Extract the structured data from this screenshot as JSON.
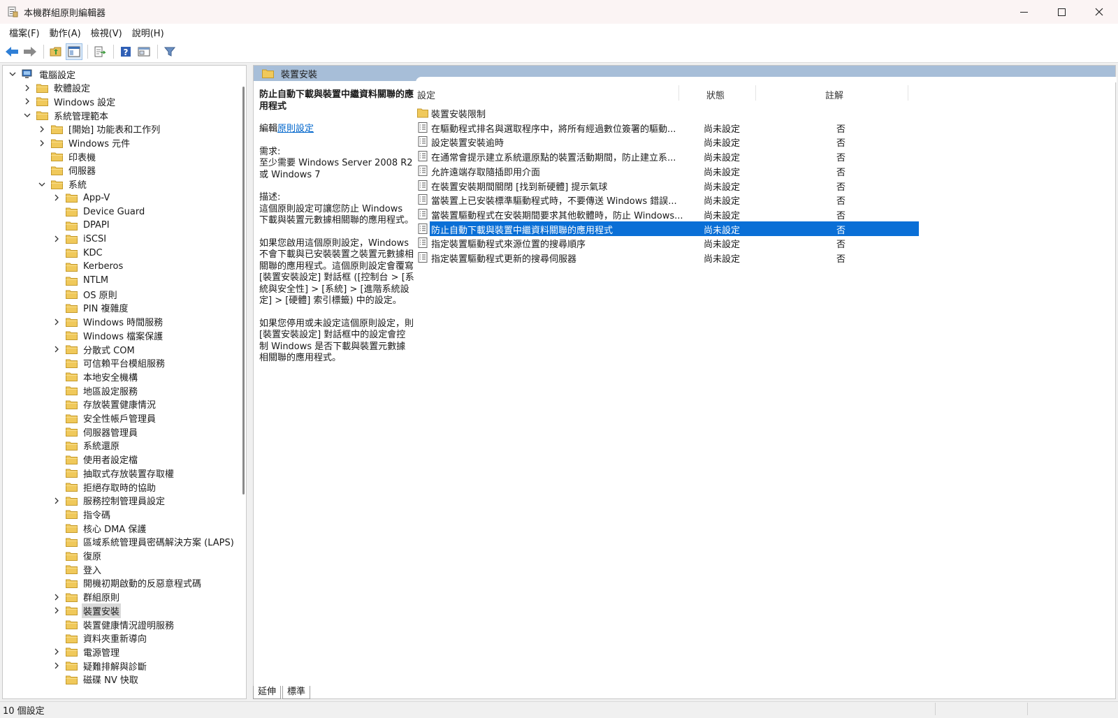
{
  "window": {
    "title": "本機群組原則編輯器"
  },
  "menu": [
    "檔案(F)",
    "動作(A)",
    "檢視(V)",
    "說明(H)"
  ],
  "toolbar": {
    "icons": [
      "back-arrow-icon",
      "forward-arrow-icon",
      "up-folder-icon",
      "show-hide-tree-icon",
      "export-list-icon",
      "help-icon",
      "properties-icon",
      "filter-icon"
    ]
  },
  "tree": [
    {
      "label": "電腦設定",
      "level": 0,
      "expander": "expanded",
      "icon": "computer"
    },
    {
      "label": "軟體設定",
      "level": 1,
      "expander": "collapsed"
    },
    {
      "label": "Windows 設定",
      "level": 1,
      "expander": "collapsed"
    },
    {
      "label": "系統管理範本",
      "level": 1,
      "expander": "expanded"
    },
    {
      "label": "[開始] 功能表和工作列",
      "level": 2,
      "expander": "collapsed"
    },
    {
      "label": "Windows 元件",
      "level": 2,
      "expander": "collapsed"
    },
    {
      "label": "印表機",
      "level": 2,
      "expander": "none"
    },
    {
      "label": "伺服器",
      "level": 2,
      "expander": "none"
    },
    {
      "label": "系統",
      "level": 2,
      "expander": "expanded"
    },
    {
      "label": "App-V",
      "level": 3,
      "expander": "collapsed"
    },
    {
      "label": "Device Guard",
      "level": 3,
      "expander": "none"
    },
    {
      "label": "DPAPI",
      "level": 3,
      "expander": "none"
    },
    {
      "label": "iSCSI",
      "level": 3,
      "expander": "collapsed"
    },
    {
      "label": "KDC",
      "level": 3,
      "expander": "none"
    },
    {
      "label": "Kerberos",
      "level": 3,
      "expander": "none"
    },
    {
      "label": "NTLM",
      "level": 3,
      "expander": "none"
    },
    {
      "label": "OS 原則",
      "level": 3,
      "expander": "none"
    },
    {
      "label": "PIN 複雜度",
      "level": 3,
      "expander": "none"
    },
    {
      "label": "Windows 時間服務",
      "level": 3,
      "expander": "collapsed"
    },
    {
      "label": "Windows 檔案保護",
      "level": 3,
      "expander": "none"
    },
    {
      "label": "分散式 COM",
      "level": 3,
      "expander": "collapsed"
    },
    {
      "label": "可信賴平台模組服務",
      "level": 3,
      "expander": "none"
    },
    {
      "label": "本地安全機構",
      "level": 3,
      "expander": "none"
    },
    {
      "label": "地區設定服務",
      "level": 3,
      "expander": "none"
    },
    {
      "label": "存放裝置健康情況",
      "level": 3,
      "expander": "none"
    },
    {
      "label": "安全性帳戶管理員",
      "level": 3,
      "expander": "none"
    },
    {
      "label": "伺服器管理員",
      "level": 3,
      "expander": "none"
    },
    {
      "label": "系統還原",
      "level": 3,
      "expander": "none"
    },
    {
      "label": "使用者設定檔",
      "level": 3,
      "expander": "none"
    },
    {
      "label": "抽取式存放裝置存取權",
      "level": 3,
      "expander": "none"
    },
    {
      "label": "拒絕存取時的協助",
      "level": 3,
      "expander": "none"
    },
    {
      "label": "服務控制管理員設定",
      "level": 3,
      "expander": "collapsed"
    },
    {
      "label": "指令碼",
      "level": 3,
      "expander": "none"
    },
    {
      "label": "核心 DMA 保護",
      "level": 3,
      "expander": "none"
    },
    {
      "label": "區域系統管理員密碼解決方案 (LAPS)",
      "level": 3,
      "expander": "none"
    },
    {
      "label": "復原",
      "level": 3,
      "expander": "none"
    },
    {
      "label": "登入",
      "level": 3,
      "expander": "none"
    },
    {
      "label": "開機初期啟動的反惡意程式碼",
      "level": 3,
      "expander": "none"
    },
    {
      "label": "群組原則",
      "level": 3,
      "expander": "collapsed"
    },
    {
      "label": "裝置安裝",
      "level": 3,
      "expander": "collapsed",
      "selected": true
    },
    {
      "label": "裝置健康情況證明服務",
      "level": 3,
      "expander": "none"
    },
    {
      "label": "資料夾重新導向",
      "level": 3,
      "expander": "none"
    },
    {
      "label": "電源管理",
      "level": 3,
      "expander": "collapsed"
    },
    {
      "label": "疑難排解與診斷",
      "level": 3,
      "expander": "collapsed"
    },
    {
      "label": "磁碟 NV 快取",
      "level": 3,
      "expander": "none"
    }
  ],
  "right": {
    "header": "裝置安裝",
    "description": {
      "title": "防止自動下載與裝置中繼資料關聯的應用程式",
      "edit_prefix": "編輯",
      "edit_link": "原則設定",
      "req_label": "需求:",
      "req_text": "至少需要 Windows Server 2008 R2 或 Windows 7",
      "desc_label": "描述:",
      "desc_text": "這個原則設定可讓您防止 Windows 下載與裝置元數據相關聯的應用程式。",
      "para2": "如果您啟用這個原則設定，Windows 不會下載與已安裝裝置之裝置元數據相關聯的應用程式。這個原則設定會覆寫 [裝置安裝設定] 對話框 ([控制台 > [系統與安全性] > [系統] > [進階系統設定] > [硬體] 索引標籤) 中的設定。",
      "para3": "如果您停用或未設定這個原則設定，則 [裝置安裝設定] 對話框中的設定會控制 Windows 是否下載與裝置元數據相關聯的應用程式。"
    },
    "columns": {
      "setting": "設定",
      "state": "狀態",
      "comment": "註解"
    },
    "rows": [
      {
        "name": "裝置安裝限制",
        "type": "folder",
        "state": "",
        "comment": ""
      },
      {
        "name": "在驅動程式排名與選取程序中，將所有經過數位簽署的驅動...",
        "type": "setting",
        "state": "尚未設定",
        "comment": "否"
      },
      {
        "name": "設定裝置安裝逾時",
        "type": "setting",
        "state": "尚未設定",
        "comment": "否"
      },
      {
        "name": "在通常會提示建立系統還原點的裝置活動期間，防止建立系...",
        "type": "setting",
        "state": "尚未設定",
        "comment": "否"
      },
      {
        "name": "允許遠端存取隨插即用介面",
        "type": "setting",
        "state": "尚未設定",
        "comment": "否"
      },
      {
        "name": "在裝置安裝期間關閉 [找到新硬體] 提示氣球",
        "type": "setting",
        "state": "尚未設定",
        "comment": "否"
      },
      {
        "name": "當裝置上已安裝標準驅動程式時，不要傳送 Windows 錯誤...",
        "type": "setting",
        "state": "尚未設定",
        "comment": "否"
      },
      {
        "name": "當裝置驅動程式在安裝期間要求其他軟體時，防止 Windows...",
        "type": "setting",
        "state": "尚未設定",
        "comment": "否"
      },
      {
        "name": "防止自動下載與裝置中繼資料關聯的應用程式",
        "type": "setting",
        "state": "尚未設定",
        "comment": "否",
        "selected": true
      },
      {
        "name": "指定裝置驅動程式來源位置的搜尋順序",
        "type": "setting",
        "state": "尚未設定",
        "comment": "否"
      },
      {
        "name": "指定裝置驅動程式更新的搜尋伺服器",
        "type": "setting",
        "state": "尚未設定",
        "comment": "否"
      }
    ]
  },
  "tabs": [
    "延伸",
    "標準"
  ],
  "status": {
    "text": "10 個設定"
  }
}
